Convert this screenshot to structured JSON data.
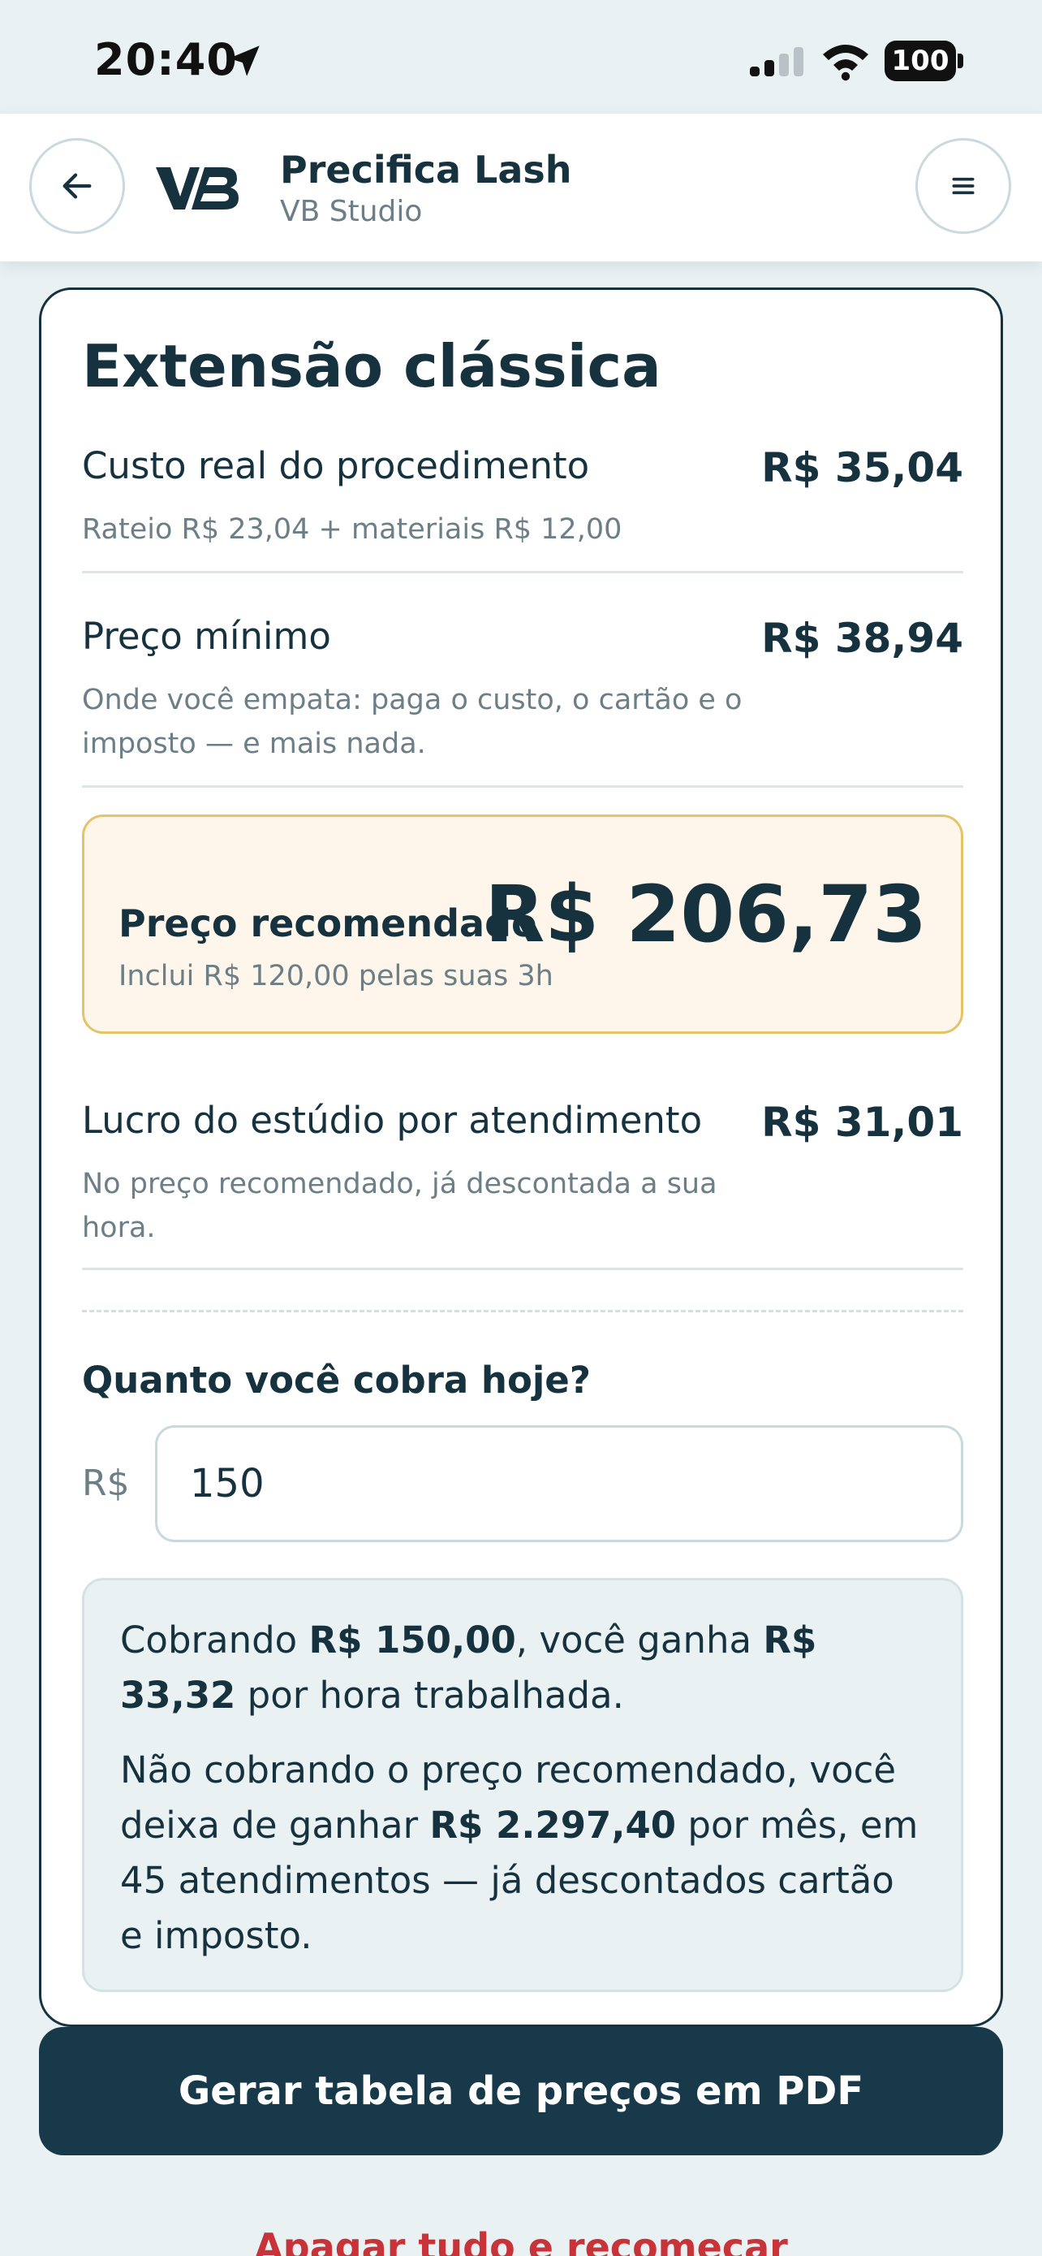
{
  "status_bar": {
    "time": "20:40",
    "battery": "100"
  },
  "header": {
    "title": "Precifica Lash",
    "subtitle": "VB Studio",
    "back_icon": "arrow-left-icon",
    "menu_icon": "menu-icon",
    "logo_text": "VB"
  },
  "card": {
    "title": "Extensão clássica",
    "cost": {
      "label": "Custo real do procedimento",
      "value": "R$ 35,04",
      "desc": "Rateio R$ 23,04 + materiais R$ 12,00"
    },
    "min_price": {
      "label": "Preço mínimo",
      "value": "R$ 38,94",
      "desc": "Onde você empata: paga o custo, o cartão e o imposto — e mais nada."
    },
    "recommended": {
      "label": "Preço recomendado",
      "value": "R$ 206,73",
      "desc": "Inclui R$ 120,00 pelas suas 3h"
    },
    "profit": {
      "label": "Lucro do estúdio por atendimento",
      "value": "R$ 31,01",
      "desc": "No preço recomendado, já descontada a sua hora."
    },
    "question": {
      "label": "Quanto você cobra hoje?",
      "currency": "R$",
      "value": "150"
    },
    "info": {
      "p1_a": "Cobrando ",
      "p1_b": "R$ 150,00",
      "p1_c": ", você ganha ",
      "p1_d": "R$ 33,32",
      "p1_e": " por hora trabalhada.",
      "p2_a": "Não cobrando o preço recomendado, você deixa de ganhar ",
      "p2_b": "R$ 2.297,40",
      "p2_c": " por mês, em 45 atendimentos — já descontados cartão e imposto."
    }
  },
  "actions": {
    "pdf_button": "Gerar tabela de preços em PDF",
    "reset_link": "Apagar tudo e recomeçar"
  },
  "colors": {
    "primary": "#17394a",
    "highlight_bg": "#fef6ea",
    "highlight_border": "#e3c469",
    "danger": "#c8333a"
  }
}
